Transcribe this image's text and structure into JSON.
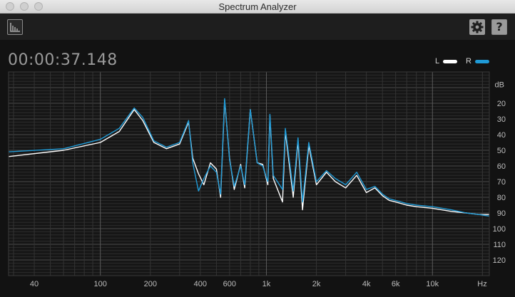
{
  "window": {
    "title": "Spectrum Analyzer"
  },
  "toolbar": {
    "view_icon": "spectrum-view-icon",
    "settings_icon": "gear-icon",
    "help_label": "?"
  },
  "timecode": "00:00:37.148",
  "legend": [
    {
      "label": "L",
      "color": "#ffffff"
    },
    {
      "label": "R",
      "color": "#1f9ad6"
    }
  ],
  "chart_data": {
    "type": "line",
    "xscale": "log",
    "xunit": "Hz",
    "yunit": "dB",
    "xlim": [
      28,
      22000
    ],
    "ylim": [
      0,
      130
    ],
    "x_tick_labels": [
      {
        "f": 40,
        "label": "40"
      },
      {
        "f": 100,
        "label": "100"
      },
      {
        "f": 200,
        "label": "200"
      },
      {
        "f": 400,
        "label": "400"
      },
      {
        "f": 600,
        "label": "600"
      },
      {
        "f": 1000,
        "label": "1k"
      },
      {
        "f": 2000,
        "label": "2k"
      },
      {
        "f": 4000,
        "label": "4k"
      },
      {
        "f": 6000,
        "label": "6k"
      },
      {
        "f": 10000,
        "label": "10k"
      }
    ],
    "y_tick_labels": [
      20,
      30,
      40,
      50,
      60,
      70,
      80,
      90,
      100,
      110,
      120
    ],
    "grid": true,
    "series": [
      {
        "name": "L",
        "color": "#ffffff",
        "points": [
          [
            28,
            54
          ],
          [
            60,
            50
          ],
          [
            100,
            45
          ],
          [
            130,
            38
          ],
          [
            160,
            24
          ],
          [
            180,
            31
          ],
          [
            210,
            45
          ],
          [
            250,
            49
          ],
          [
            300,
            46
          ],
          [
            340,
            32
          ],
          [
            360,
            55
          ],
          [
            390,
            65
          ],
          [
            420,
            72
          ],
          [
            460,
            58
          ],
          [
            500,
            62
          ],
          [
            530,
            80
          ],
          [
            560,
            18
          ],
          [
            600,
            55
          ],
          [
            640,
            75
          ],
          [
            700,
            59
          ],
          [
            740,
            74
          ],
          [
            800,
            24
          ],
          [
            880,
            58
          ],
          [
            950,
            59
          ],
          [
            1020,
            72
          ],
          [
            1050,
            28
          ],
          [
            1100,
            68
          ],
          [
            1250,
            83
          ],
          [
            1300,
            38
          ],
          [
            1450,
            80
          ],
          [
            1550,
            44
          ],
          [
            1650,
            88
          ],
          [
            1800,
            47
          ],
          [
            2000,
            72
          ],
          [
            2300,
            64
          ],
          [
            2600,
            70
          ],
          [
            3000,
            74
          ],
          [
            3500,
            66
          ],
          [
            4000,
            77
          ],
          [
            4500,
            74
          ],
          [
            5000,
            79
          ],
          [
            5500,
            82
          ],
          [
            6000,
            83
          ],
          [
            7000,
            85
          ],
          [
            8000,
            86
          ],
          [
            10000,
            87
          ],
          [
            13000,
            89
          ],
          [
            16000,
            90
          ],
          [
            19000,
            91
          ],
          [
            22000,
            91
          ]
        ]
      },
      {
        "name": "R",
        "color": "#1f9ad6",
        "points": [
          [
            28,
            51
          ],
          [
            60,
            49
          ],
          [
            100,
            43
          ],
          [
            130,
            36
          ],
          [
            160,
            23
          ],
          [
            180,
            29
          ],
          [
            210,
            44
          ],
          [
            250,
            48
          ],
          [
            300,
            45
          ],
          [
            340,
            31
          ],
          [
            360,
            58
          ],
          [
            390,
            76
          ],
          [
            420,
            68
          ],
          [
            460,
            60
          ],
          [
            500,
            64
          ],
          [
            530,
            78
          ],
          [
            560,
            17
          ],
          [
            600,
            56
          ],
          [
            640,
            73
          ],
          [
            700,
            60
          ],
          [
            740,
            72
          ],
          [
            800,
            24
          ],
          [
            880,
            58
          ],
          [
            950,
            60
          ],
          [
            1020,
            70
          ],
          [
            1050,
            27
          ],
          [
            1100,
            66
          ],
          [
            1250,
            75
          ],
          [
            1300,
            36
          ],
          [
            1450,
            76
          ],
          [
            1550,
            42
          ],
          [
            1650,
            83
          ],
          [
            1800,
            45
          ],
          [
            2000,
            70
          ],
          [
            2300,
            63
          ],
          [
            2600,
            68
          ],
          [
            3000,
            72
          ],
          [
            3500,
            64
          ],
          [
            4000,
            75
          ],
          [
            4500,
            73
          ],
          [
            5000,
            78
          ],
          [
            5500,
            81
          ],
          [
            6000,
            82
          ],
          [
            7000,
            84
          ],
          [
            8000,
            85
          ],
          [
            10000,
            86
          ],
          [
            13000,
            88
          ],
          [
            16000,
            90
          ],
          [
            19000,
            91
          ],
          [
            22000,
            92
          ]
        ]
      }
    ]
  }
}
